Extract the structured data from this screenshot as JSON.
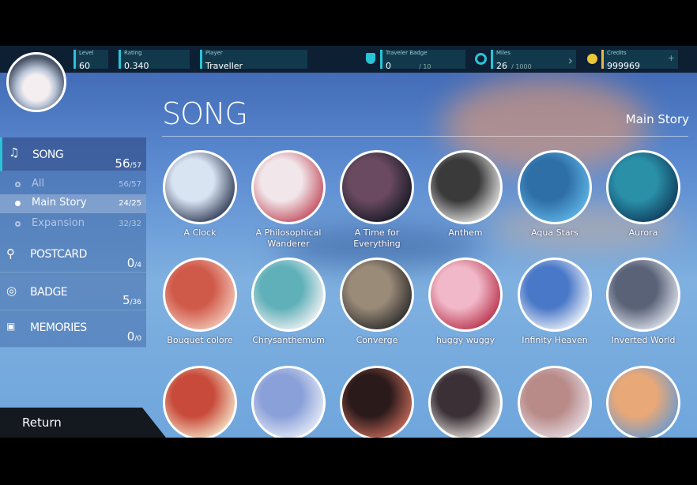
{
  "header": {
    "level": {
      "label": "Level",
      "value": "60"
    },
    "rating": {
      "label": "Rating",
      "value": "0.340"
    },
    "player": {
      "label": "Player",
      "value": "Traveller"
    },
    "badge": {
      "label": "Traveler Badge",
      "value": "0",
      "max": "/ 10"
    },
    "miles": {
      "label": "Miles",
      "value": "26",
      "max": "/ 1000"
    },
    "credits": {
      "label": "Credits",
      "value": "999969"
    },
    "accent": "#29c4d6",
    "credits_accent": "#e8b84a"
  },
  "sidebar": {
    "items": [
      {
        "label": "SONG",
        "count": "56",
        "max": "/57",
        "icon": "music-note-icon"
      },
      {
        "label": "POSTCARD",
        "count": "0",
        "max": "/4",
        "icon": "location-pin-icon"
      },
      {
        "label": "BADGE",
        "count": "5",
        "max": "/36",
        "icon": "badge-icon"
      },
      {
        "label": "MEMORIES",
        "count": "0",
        "max": "/0",
        "icon": "image-icon"
      }
    ],
    "sub": [
      {
        "label": "All",
        "count": "56/57"
      },
      {
        "label": "Main Story",
        "count": "24/25",
        "selected": true
      },
      {
        "label": "Expansion",
        "count": "32/32"
      }
    ],
    "return_label": "Return"
  },
  "main": {
    "title": "SONG",
    "category": "Main Story",
    "songs": [
      {
        "name": "A Clock",
        "colors": [
          "#2a3550",
          "#d9e4f3"
        ]
      },
      {
        "name": "A Philosophical Wanderer",
        "colors": [
          "#c24a5a",
          "#f1e6ea"
        ]
      },
      {
        "name": "A Time for Everything",
        "colors": [
          "#141824",
          "#6a4a60"
        ]
      },
      {
        "name": "Anthem",
        "colors": [
          "#e6e6e6",
          "#3a3a3a"
        ]
      },
      {
        "name": "Aqua Stars",
        "colors": [
          "#5fb6e8",
          "#2f6fa8"
        ]
      },
      {
        "name": "Aurora",
        "colors": [
          "#0e3a5a",
          "#2a90a8"
        ]
      },
      {
        "name": "Bouquet colore",
        "colors": [
          "#f3c7b8",
          "#d05a4a"
        ]
      },
      {
        "name": "Chrysanthemum",
        "colors": [
          "#f3f3f6",
          "#5fb0b8"
        ]
      },
      {
        "name": "Converge",
        "colors": [
          "#2a2a2a",
          "#9a8a78"
        ]
      },
      {
        "name": "huggy wuggy",
        "colors": [
          "#b8304a",
          "#f0b8c8"
        ]
      },
      {
        "name": "Infinity Heaven",
        "colors": [
          "#f0f4fa",
          "#4a78c8"
        ]
      },
      {
        "name": "Inverted World",
        "colors": [
          "#dfe4ee",
          "#5a6278"
        ]
      },
      {
        "name": "",
        "colors": [
          "#f5e4c8",
          "#c84a3a"
        ]
      },
      {
        "name": "",
        "colors": [
          "#e8ecf8",
          "#8aa0d8"
        ]
      },
      {
        "name": "",
        "colors": [
          "#c86a5a",
          "#2a1a1a"
        ]
      },
      {
        "name": "",
        "colors": [
          "#e8e4e0",
          "#3a3036"
        ]
      },
      {
        "name": "",
        "colors": [
          "#e6dce4",
          "#b88a88"
        ]
      },
      {
        "name": "",
        "colors": [
          "#6a9ad0",
          "#e8a878"
        ]
      }
    ]
  }
}
